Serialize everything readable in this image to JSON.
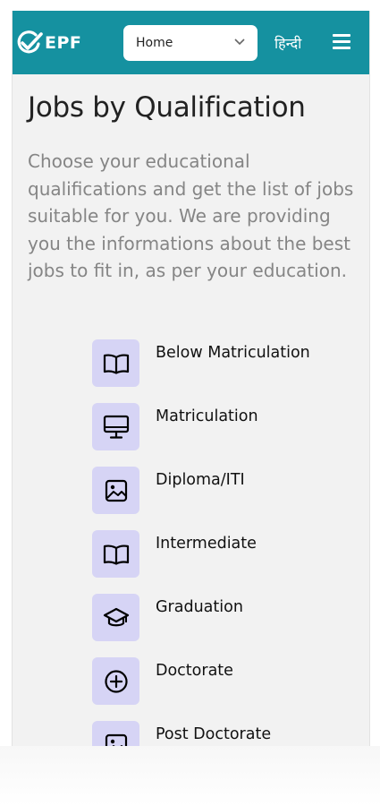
{
  "header": {
    "logo_text": "EPF",
    "select_value": "Home",
    "language_label": "हिन्दी"
  },
  "page": {
    "title": "Jobs by Qualification",
    "description": "Choose your educational qualifications and get the list of jobs suitable for you. We are providing you the informations about the best jobs to fit in, as per your education."
  },
  "qualifications": [
    {
      "label": "Below Matriculation",
      "icon": "book-icon"
    },
    {
      "label": "Matriculation",
      "icon": "monitor-icon"
    },
    {
      "label": "Diploma/ITI",
      "icon": "image-icon"
    },
    {
      "label": "Intermediate",
      "icon": "book-icon"
    },
    {
      "label": "Graduation",
      "icon": "graduation-cap-icon"
    },
    {
      "label": "Doctorate",
      "icon": "plus-circle-icon"
    },
    {
      "label": "Post Doctorate",
      "icon": "image-icon"
    }
  ],
  "colors": {
    "header_bg": "#1591a0",
    "icon_tile_bg": "#d6d4f5",
    "page_bg": "#f2f2f2"
  }
}
